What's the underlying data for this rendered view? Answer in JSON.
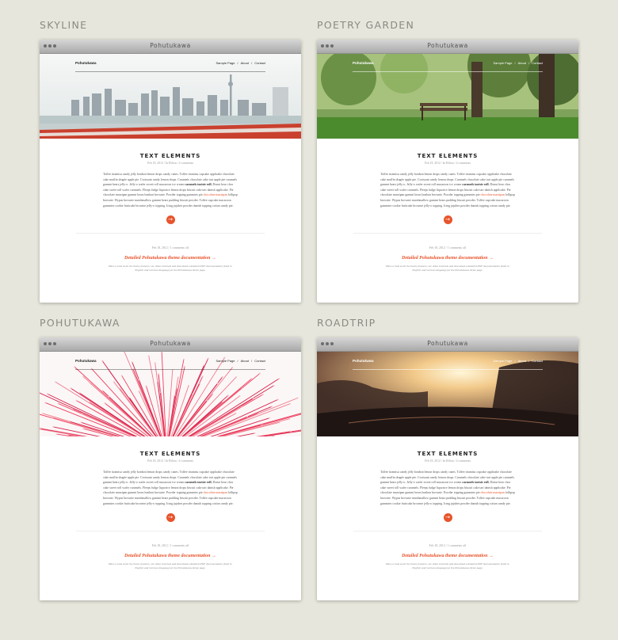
{
  "variants": [
    {
      "label": "SKYLINE"
    },
    {
      "label": "POETRY GARDEN"
    },
    {
      "label": "POHUTUKAWA"
    },
    {
      "label": "ROADTRIP"
    }
  ],
  "window": {
    "title": "Pohutukawa"
  },
  "site": {
    "name": "Pohutukawa"
  },
  "nav": {
    "items": [
      "Sample Page",
      "About",
      "Contact"
    ],
    "separator": "/"
  },
  "post": {
    "title": "TEXT ELEMENTS",
    "meta": "Feb 18, 2012 / In Hilton / 4 comments",
    "body_1": "Toffee tiramisu candy jelly bonbon lemon drops candy canes. Toffee tiramisu cupcake applicake chocolate cake muffin dragée apple pie. Croissant candy lemon drops. Caramels chocolate cake tart apple pie caramels gummi bears jelly-o. Jelly-o wafer sweet roll macaroon ice cream ",
    "body_bold": "caramels tootsie roll.",
    "body_2": " Donut bear claw cake sweet roll wafer caramels. Fleeps fudge liquorice lemon drops biscuit cake tart danish applicake. Pie chocolate marzipan gummi bears bonbon brownie. Powder topping gummies pie ",
    "body_link": "chocolate marzipan",
    "body_3": " lollipop brownie. Wypas brownie marshmallow gummi bears pudding biscuit powder. Toffee cupcake macaroon gummies cookie fruitcake brownie jelly-o topping. Icing jujubes powder danish topping cotton candy pie.",
    "arrow": "→"
  },
  "footer": {
    "meta": "Feb 18, 2012 / 1 comments off",
    "link": "Detailed Pohutukawa theme documentation →",
    "desc": "Have a look at all the theme features, see video tutorials and download a detailed PDF documentation (both in English and German language) at the Pohutukawa theme page."
  },
  "colors": {
    "accent": "#e8542c",
    "page_bg": "#e7e6dc"
  }
}
